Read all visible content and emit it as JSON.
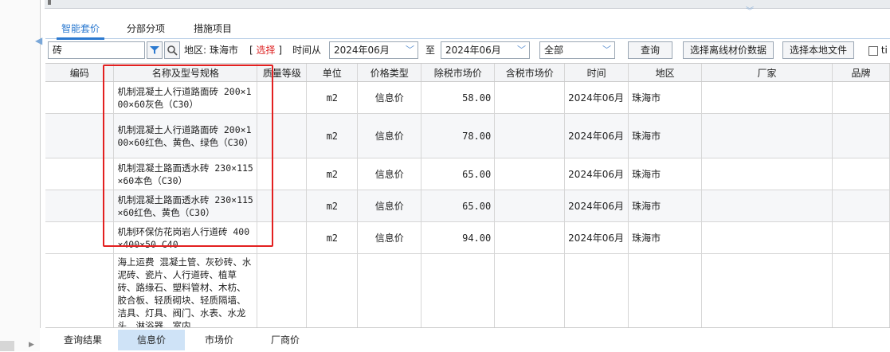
{
  "tabs": [
    {
      "label": "智能套价",
      "active": true
    },
    {
      "label": "分部分项",
      "active": false
    },
    {
      "label": "措施项目",
      "active": false
    }
  ],
  "toolbar": {
    "search_value": "砖",
    "region_label": "地区: 珠海市",
    "select_link": "选择",
    "time_from_label": "时间从",
    "time_from": "2024年06月",
    "to_label": "至",
    "time_to": "2024年06月",
    "scope": "全部",
    "query_button": "查询",
    "offline_button": "选择离线材价数据",
    "local_file_button": "选择本地文件",
    "checkbox_label": "ti"
  },
  "table": {
    "headers": [
      "编码",
      "名称及型号规格",
      "质量等级",
      "单位",
      "价格类型",
      "除税市场价",
      "含税市场价",
      "时间",
      "地区",
      "厂家",
      "品牌"
    ],
    "rows": [
      {
        "code": "",
        "name": "机制混凝土人行道路面砖 200×100×60灰色（C30）",
        "grade": "",
        "unit": "m2",
        "price_type": "信息价",
        "ex_tax": "58.00",
        "inc_tax": "",
        "time": "2024年06月",
        "region": "珠海市",
        "maker": "",
        "brand": ""
      },
      {
        "code": "",
        "name": "机制混凝土人行道路面砖 200×100×60红色、黄色、绿色（C30）",
        "grade": "",
        "unit": "m2",
        "price_type": "信息价",
        "ex_tax": "78.00",
        "inc_tax": "",
        "time": "2024年06月",
        "region": "珠海市",
        "maker": "",
        "brand": ""
      },
      {
        "code": "",
        "name": "机制混凝土路面透水砖 230×115×60本色（C30）",
        "grade": "",
        "unit": "m2",
        "price_type": "信息价",
        "ex_tax": "65.00",
        "inc_tax": "",
        "time": "2024年06月",
        "region": "珠海市",
        "maker": "",
        "brand": ""
      },
      {
        "code": "",
        "name": "机制混凝土路面透水砖 230×115×60红色、黄色（C30）",
        "grade": "",
        "unit": "m2",
        "price_type": "信息价",
        "ex_tax": "65.00",
        "inc_tax": "",
        "time": "2024年06月",
        "region": "珠海市",
        "maker": "",
        "brand": ""
      },
      {
        "code": "",
        "name": "机制环保仿花岗岩人行道砖 400×400×50 C40",
        "grade": "",
        "unit": "m2",
        "price_type": "信息价",
        "ex_tax": "94.00",
        "inc_tax": "",
        "time": "2024年06月",
        "region": "珠海市",
        "maker": "",
        "brand": ""
      },
      {
        "code": "",
        "name": "海上运费 混凝土管、灰砂砖、水泥砖、瓷片、人行道砖、植草砖、路缘石、塑料管材、木枋、胶合板、轻质砌块、轻质隔墙、洁具、灯具、阀门、水表、水龙头、淋浴器、室内",
        "grade": "",
        "unit": "",
        "price_type": "",
        "ex_tax": "",
        "inc_tax": "",
        "time": "",
        "region": "",
        "maker": "",
        "brand": ""
      }
    ]
  },
  "bottom_tabs": [
    {
      "label": "查询结果",
      "active": false
    },
    {
      "label": "信息价",
      "active": true
    },
    {
      "label": "市场价",
      "active": false
    },
    {
      "label": "厂商价",
      "active": false
    }
  ],
  "colors": {
    "accent": "#2b79d0",
    "highlight_border": "#e32020",
    "active_tab_bg": "#cfe3f7"
  },
  "icons": [
    "filter-icon",
    "search-icon",
    "dropdown-arrow-icon",
    "collapse-chevron-icon",
    "expand-left-icon"
  ]
}
